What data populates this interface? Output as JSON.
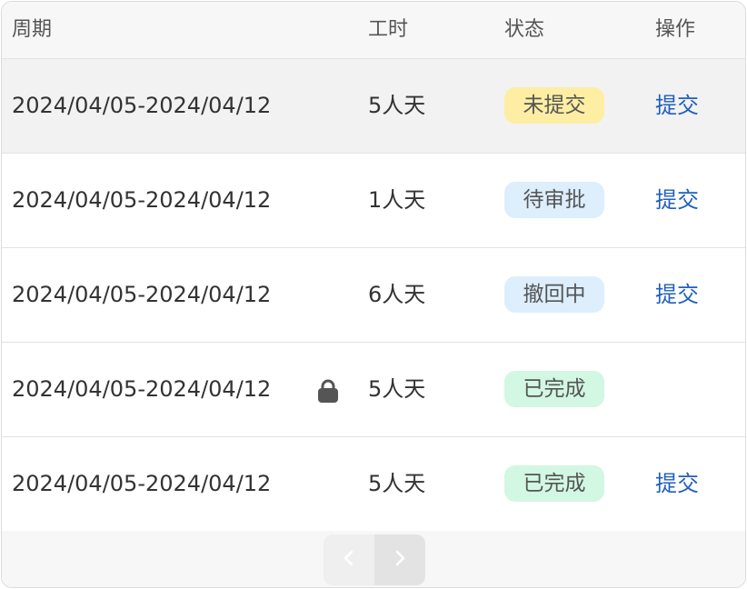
{
  "table": {
    "headers": {
      "period": "周期",
      "hours": "工时",
      "status": "状态",
      "action": "操作"
    },
    "rows": [
      {
        "period": "2024/04/05-2024/04/12",
        "hours": "5人天",
        "status": "未提交",
        "status_bg": "#fdeea3",
        "action": "提交",
        "locked": false
      },
      {
        "period": "2024/04/05-2024/04/12",
        "hours": "1人天",
        "status": "待审批",
        "status_bg": "#ddeefd",
        "action": "提交",
        "locked": false
      },
      {
        "period": "2024/04/05-2024/04/12",
        "hours": "6人天",
        "status": "撤回中",
        "status_bg": "#ddeefd",
        "action": "提交",
        "locked": false
      },
      {
        "period": "2024/04/05-2024/04/12",
        "hours": "5人天",
        "status": "已完成",
        "status_bg": "#d2f7e2",
        "action": "",
        "locked": true
      },
      {
        "period": "2024/04/05-2024/04/12",
        "hours": "5人天",
        "status": "已完成",
        "status_bg": "#d2f7e2",
        "action": "提交",
        "locked": false
      }
    ]
  },
  "pagination": {
    "prev_icon": "chevron-left-icon",
    "next_icon": "chevron-right-icon"
  },
  "colors": {
    "link": "#1f5fbf",
    "header_bg": "#f7f7f7",
    "highlight_row_bg": "#f2f2f2"
  }
}
